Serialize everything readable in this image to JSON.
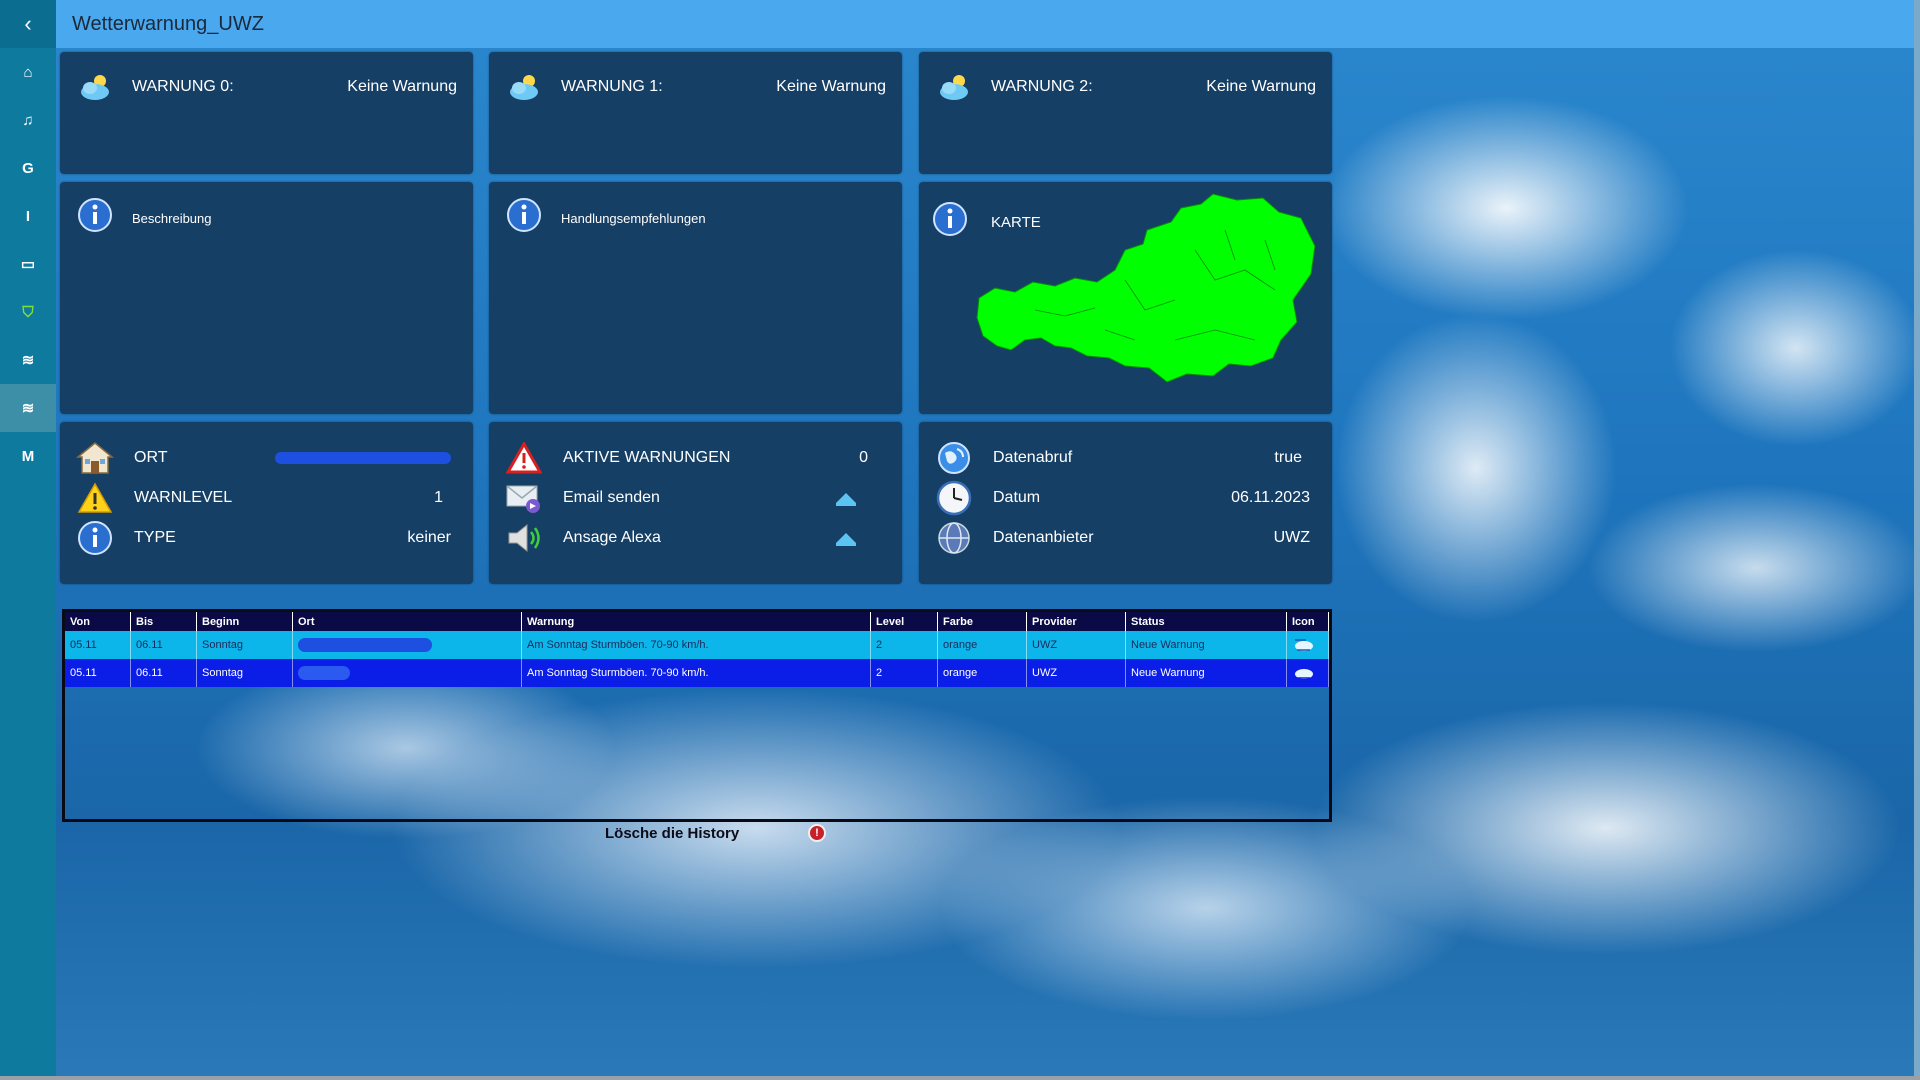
{
  "header": {
    "title": "Wetterwarnung_UWZ"
  },
  "sidebar": {
    "items": [
      {
        "icon": "home-icon",
        "glyph": "⌂"
      },
      {
        "icon": "music-icon",
        "glyph": "♫"
      },
      {
        "icon": "letter-g",
        "glyph": "G"
      },
      {
        "icon": "letter-i",
        "glyph": "I"
      },
      {
        "icon": "device-icon",
        "glyph": "▭"
      },
      {
        "icon": "shield-icon",
        "glyph": "⛉"
      },
      {
        "icon": "weather-icon",
        "glyph": "≋"
      },
      {
        "icon": "weather-icon-active",
        "glyph": "≋"
      },
      {
        "icon": "letter-m",
        "glyph": "M"
      }
    ]
  },
  "warnings": [
    {
      "label": "WARNUNG 0:",
      "value": "Keine Warnung"
    },
    {
      "label": "WARNUNG 1:",
      "value": "Keine Warnung"
    },
    {
      "label": "WARNUNG 2:",
      "value": "Keine Warnung"
    }
  ],
  "info": {
    "beschreibung": "Beschreibung",
    "handlung": "Handlungsempfehlungen",
    "karte": "KARTE"
  },
  "ort_panel": {
    "ort_label": "ORT",
    "warnlevel_label": "WARNLEVEL",
    "warnlevel_value": "1",
    "type_label": "TYPE",
    "type_value": "keiner"
  },
  "action_panel": {
    "aktive_label": "AKTIVE WARNUNGEN",
    "aktive_value": "0",
    "email_label": "Email senden",
    "alexa_label": "Ansage Alexa"
  },
  "data_panel": {
    "abruf_label": "Datenabruf",
    "abruf_value": "true",
    "datum_label": "Datum",
    "datum_value": "06.11.2023",
    "anbieter_label": "Datenanbieter",
    "anbieter_value": "UWZ"
  },
  "table": {
    "columns": [
      "Von",
      "Bis",
      "Beginn",
      "Ort",
      "Warnung",
      "Level",
      "Farbe",
      "Provider",
      "Status",
      "Icon"
    ],
    "rows": [
      {
        "von": "05.11",
        "bis": "06.11",
        "beginn": "Sonntag",
        "warnung": "Am Sonntag Sturmböen. 70-90 km/h.",
        "level": "2",
        "farbe": "orange",
        "provider": "UWZ",
        "status": "Neue Warnung"
      },
      {
        "von": "05.11",
        "bis": "06.11",
        "beginn": "Sonntag",
        "warnung": "Am Sonntag Sturmböen. 70-90 km/h.",
        "level": "2",
        "farbe": "orange",
        "provider": "UWZ",
        "status": "Neue Warnung"
      }
    ]
  },
  "history": {
    "label": "Lösche die History",
    "button_glyph": "!"
  },
  "colors": {
    "accent": "#4aa8ef",
    "sidebar": "#0e7a9e",
    "tile": "#163f66",
    "map": "#00ff00"
  }
}
